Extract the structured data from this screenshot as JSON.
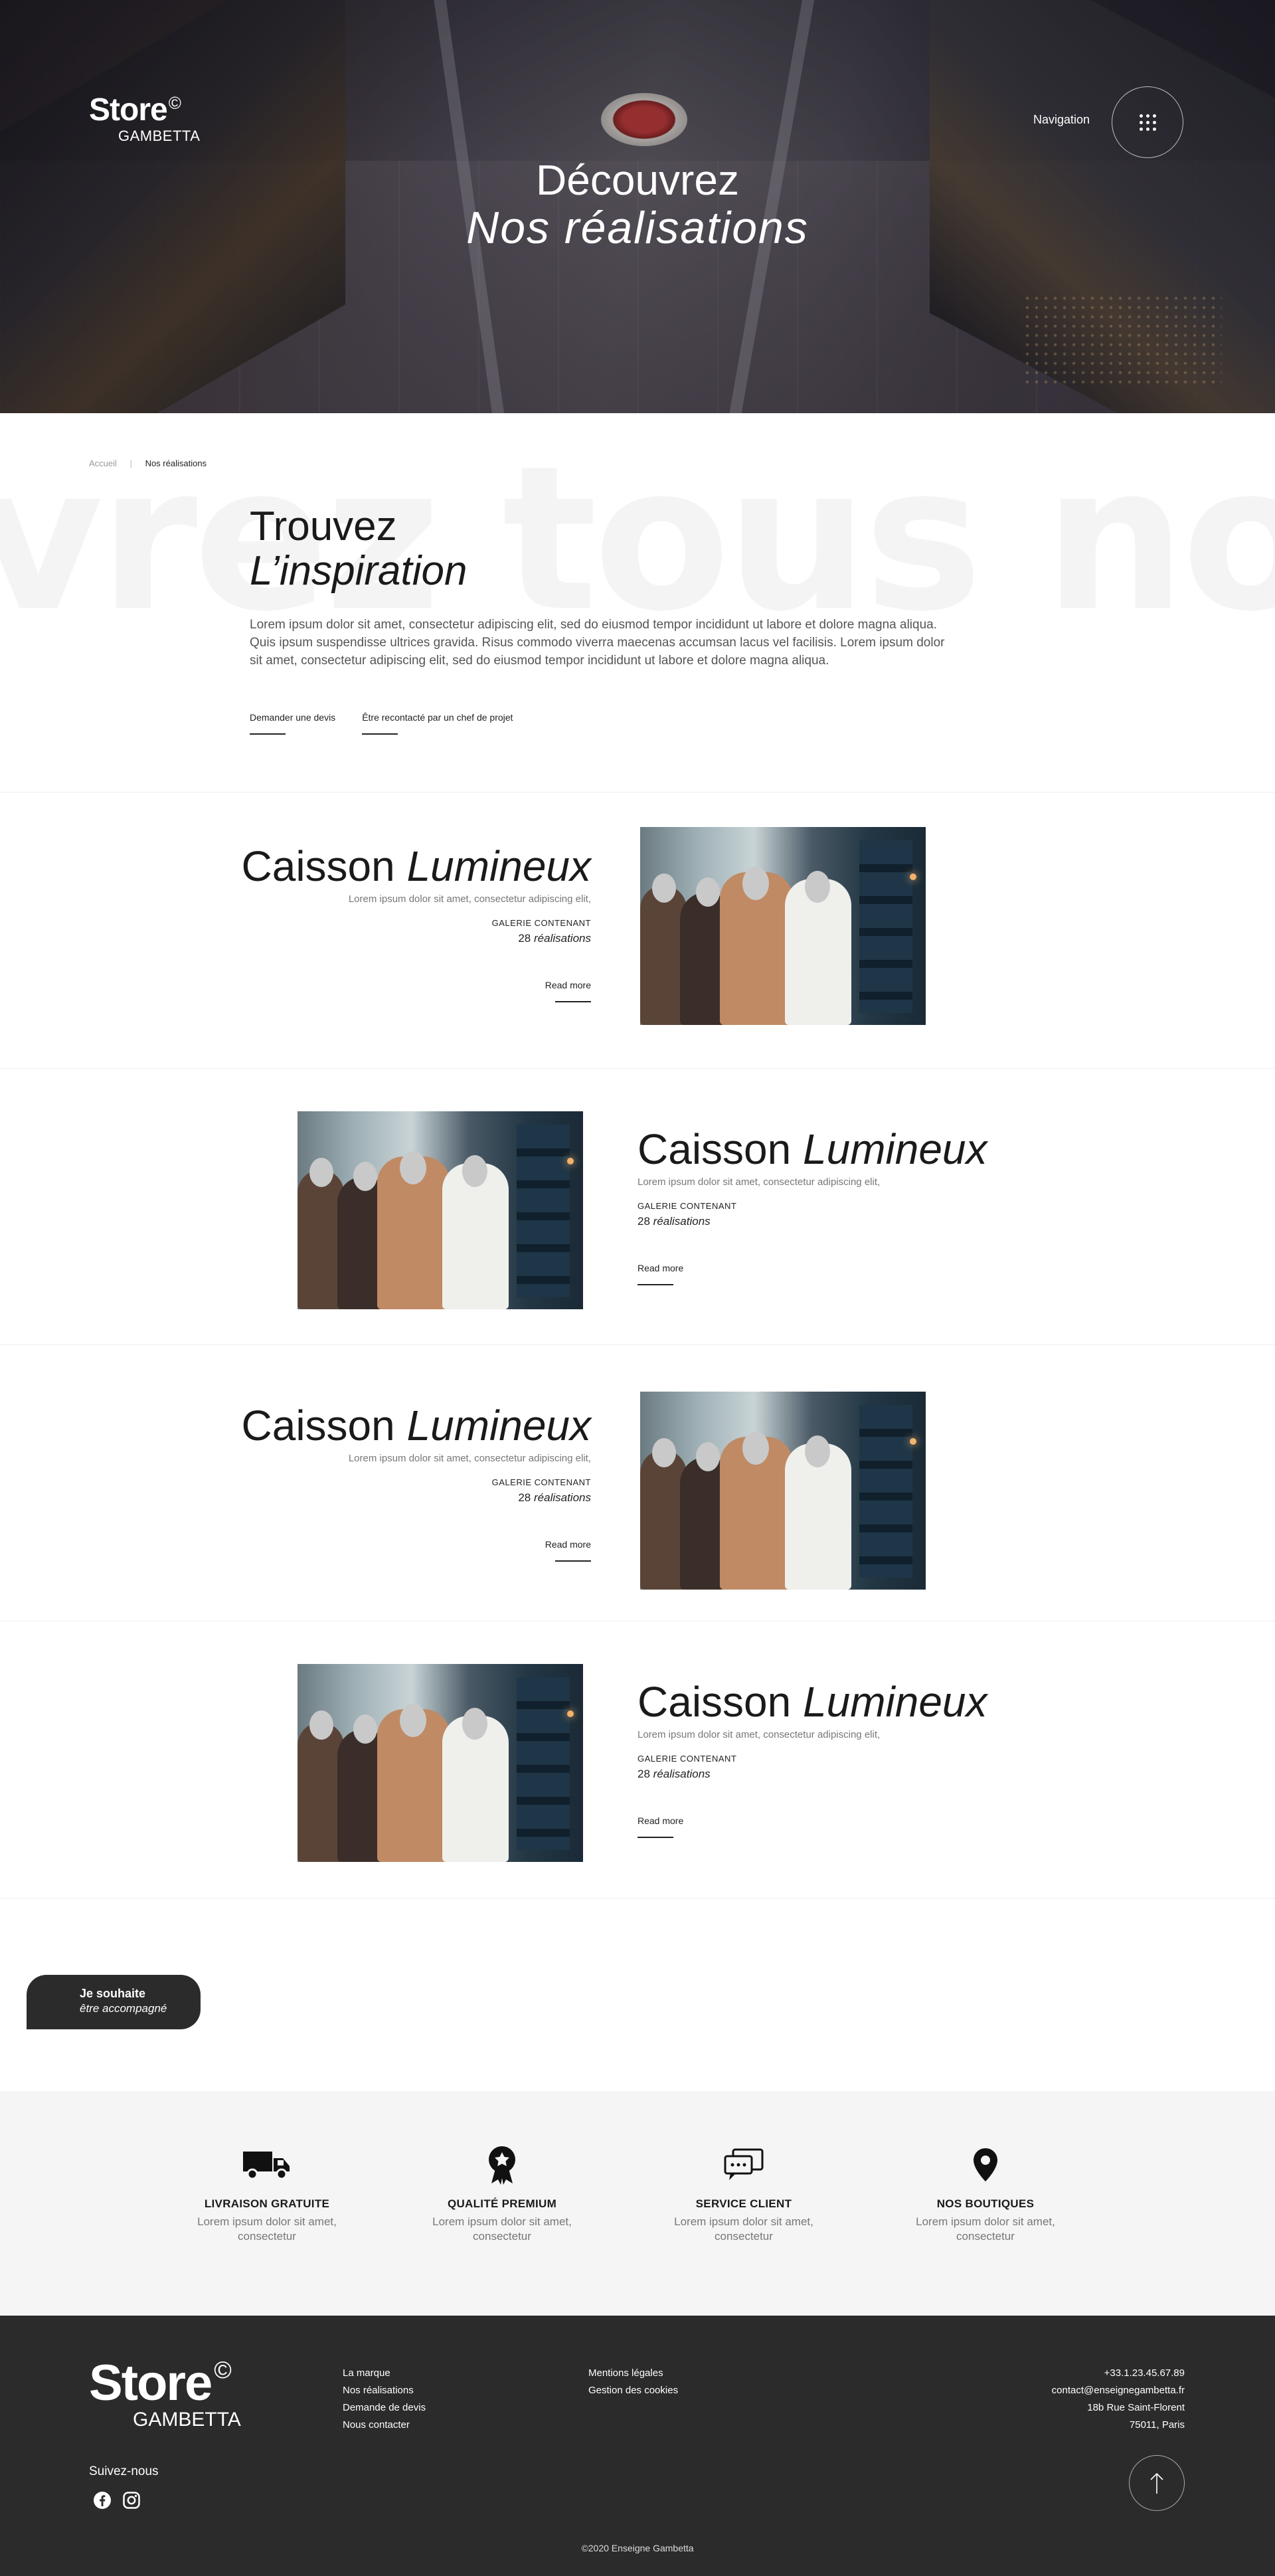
{
  "header": {
    "logo_top": "Store",
    "logo_copy": "©",
    "logo_bottom": "GAMBETTA",
    "nav_label": "Navigation",
    "title_line1": "Découvrez",
    "title_line2": "Nos réalisations"
  },
  "breadcrumb": {
    "home": "Accueil",
    "separator": "|",
    "current": "Nos réalisations"
  },
  "intro": {
    "background_text": "vrez tous nos mé",
    "title_line1": "Trouvez",
    "title_line2": "L’inspiration",
    "paragraph": "Lorem ipsum dolor sit amet, consectetur adipiscing elit, sed do eiusmod tempor incididunt ut labore et dolore magna aliqua. Quis ipsum suspendisse ultrices gravida. Risus commodo viverra maecenas accumsan lacus vel facilisis. Lorem ipsum dolor sit amet, consectetur adipiscing elit, sed do eiusmod tempor incididunt ut labore et dolore magna aliqua.",
    "link_quote": "Demander une devis",
    "link_contact": "Être recontacté par un chef de projet"
  },
  "gallery": [
    {
      "title": "Caisson",
      "title_em": "Lumineux",
      "subtitle": "Lorem ipsum dolor sit amet, consectetur adipiscing elit,",
      "label": "GALERIE CONTENANT",
      "count": "28",
      "count_label": "réalisations",
      "read_more": "Read more"
    },
    {
      "title": "Caisson",
      "title_em": "Lumineux",
      "subtitle": "Lorem ipsum dolor sit amet, consectetur adipiscing elit,",
      "label": "GALERIE CONTENANT",
      "count": "28",
      "count_label": "réalisations",
      "read_more": "Read more"
    },
    {
      "title": "Caisson",
      "title_em": "Lumineux",
      "subtitle": "Lorem ipsum dolor sit amet, consectetur adipiscing elit,",
      "label": "GALERIE CONTENANT",
      "count": "28",
      "count_label": "réalisations",
      "read_more": "Read more"
    },
    {
      "title": "Caisson",
      "title_em": "Lumineux",
      "subtitle": "Lorem ipsum dolor sit amet, consectetur adipiscing elit,",
      "label": "GALERIE CONTENANT",
      "count": "28",
      "count_label": "réalisations",
      "read_more": "Read more"
    }
  ],
  "cta": {
    "line1": "Je souhaite",
    "line2": "être accompagné"
  },
  "features": [
    {
      "icon": "truck-icon",
      "title": "LIVRAISON GRATUITE",
      "text": "Lorem ipsum dolor sit amet, consectetur"
    },
    {
      "icon": "award-icon",
      "title": "QUALITÉ PREMIUM",
      "text": "Lorem ipsum dolor sit amet, consectetur"
    },
    {
      "icon": "chat-icon",
      "title": "SERVICE CLIENT",
      "text": "Lorem ipsum dolor sit amet, consectetur"
    },
    {
      "icon": "map-pin-icon",
      "title": "NOS BOUTIQUES",
      "text": "Lorem ipsum dolor sit amet, consectetur"
    }
  ],
  "footer": {
    "logo_top": "Store",
    "logo_copy": "©",
    "logo_bottom": "GAMBETTA",
    "links_col1": [
      "La marque",
      "Nos réalisations",
      "Demande de devis",
      "Nous contacter"
    ],
    "links_col2": [
      "Mentions légales",
      "Gestion des cookies"
    ],
    "phone": "+33.1.23.45.67.89",
    "email": "contact@enseignegambetta.fr",
    "street": "18b Rue Saint-Florent",
    "city": "75011, Paris",
    "follow": "Suivez-nous",
    "copyright": "©2020 Enseigne Gambetta"
  },
  "colors": {
    "dark": "#2b2b2b",
    "light_bg": "#f5f5f5",
    "text_muted": "#777777"
  }
}
